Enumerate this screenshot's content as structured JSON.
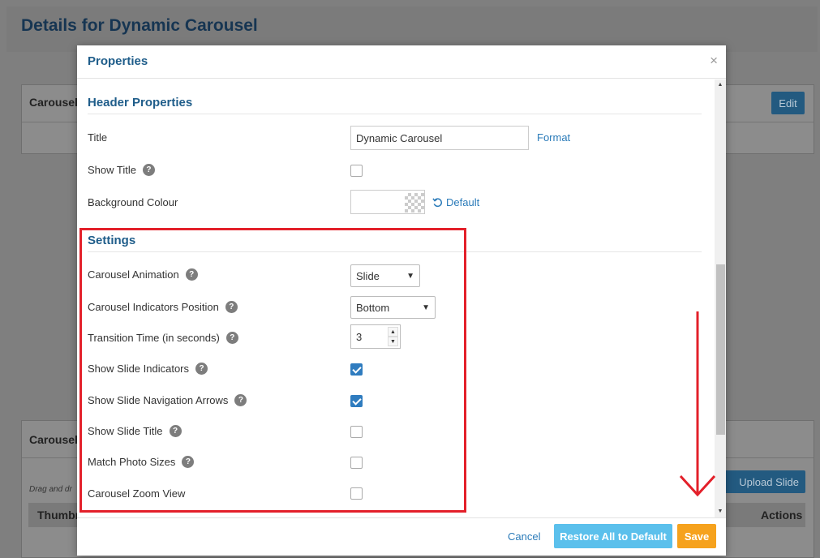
{
  "page": {
    "title": "Details for Dynamic Carousel",
    "panel1_label": "Carousel",
    "panel1_edit": "Edit",
    "panel2_label": "Carousel",
    "panel2_hint": "Drag and dr",
    "panel2_upload": "Upload Slide",
    "col_thumb": "Thumbn",
    "col_actions": "Actions"
  },
  "modal": {
    "title": "Properties",
    "close_glyph": "×",
    "header_section": {
      "title": "Header Properties",
      "title_label": "Title",
      "title_value": "Dynamic Carousel",
      "format_link": "Format",
      "show_title_label": "Show Title",
      "show_title_checked": false,
      "bg_colour_label": "Background Colour",
      "default_link": "Default"
    },
    "settings_section": {
      "title": "Settings",
      "animation_label": "Carousel Animation",
      "animation_value": "Slide",
      "indicators_pos_label": "Carousel Indicators Position",
      "indicators_pos_value": "Bottom",
      "transition_label": "Transition Time (in seconds)",
      "transition_value": "3",
      "show_indicators_label": "Show Slide Indicators",
      "show_indicators_checked": true,
      "show_arrows_label": "Show Slide Navigation Arrows",
      "show_arrows_checked": true,
      "show_slide_title_label": "Show Slide Title",
      "show_slide_title_checked": false,
      "match_photo_label": "Match Photo Sizes",
      "match_photo_checked": false,
      "zoom_view_label": "Carousel Zoom View",
      "zoom_view_checked": false
    },
    "footer": {
      "cancel": "Cancel",
      "restore": "Restore All to Default",
      "save": "Save"
    }
  },
  "colors": {
    "accent_blue": "#1f5d8a",
    "link_blue": "#2b7bb9",
    "restore_button": "#5bc0ec",
    "save_button": "#f6a21d",
    "annotation_red": "#e3202a"
  }
}
